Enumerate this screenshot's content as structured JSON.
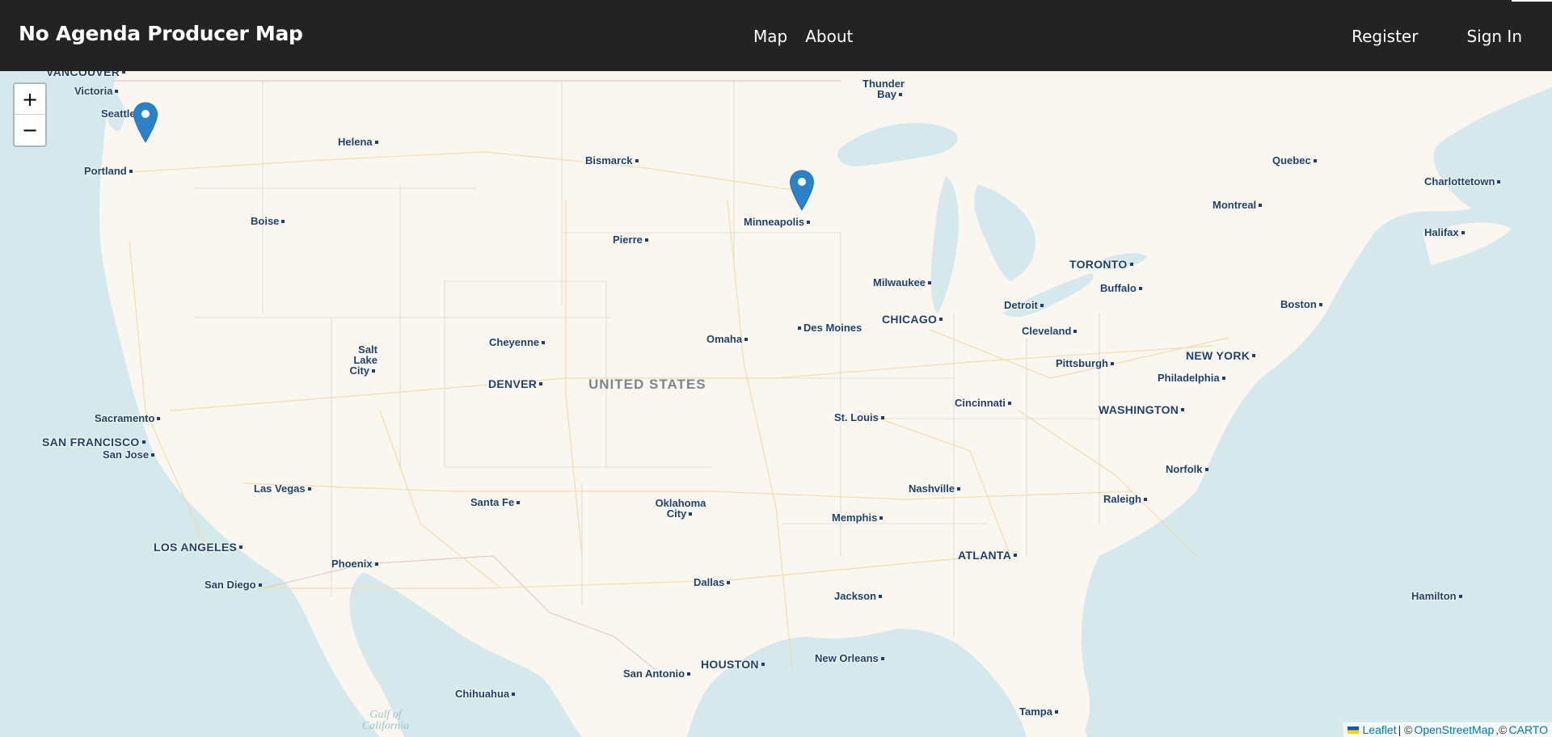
{
  "navbar": {
    "brand": "No Agenda Producer Map",
    "links": [
      "Map",
      "About"
    ],
    "register": "Register",
    "sign_in": "Sign In"
  },
  "zoom": {
    "in": "+",
    "out": "−"
  },
  "map": {
    "country_label": "UNITED STATES",
    "water_label": "Gulf of California",
    "cities": {
      "vancouver": "VANCOUVER",
      "victoria": "Victoria",
      "seattle": "Seattle",
      "portland": "Portland",
      "helena": "Helena",
      "boise": "Boise",
      "bismarck": "Bismarck",
      "pierre": "Pierre",
      "thunder_bay": "Thunder Bay",
      "minneapolis": "Minneapolis",
      "quebec": "Quebec",
      "charlottetown": "Charlottetown",
      "montreal": "Montreal",
      "halifax": "Halifax",
      "toronto": "TORONTO",
      "buffalo": "Buffalo",
      "milwaukee": "Milwaukee",
      "detroit": "Detroit",
      "boston": "Boston",
      "chicago": "CHICAGO",
      "cleveland": "Cleveland",
      "des_moines": "Des Moines",
      "omaha": "Omaha",
      "cheyenne": "Cheyenne",
      "salt_lake_city": "Salt Lake City",
      "denver": "DENVER",
      "pittsburgh": "Pittsburgh",
      "new_york": "NEW YORK",
      "philadelphia": "Philadelphia",
      "washington": "WASHINGTON",
      "cincinnati": "Cincinnati",
      "st_louis": "St. Louis",
      "sacramento": "Sacramento",
      "san_francisco": "SAN FRANCISCO",
      "san_jose": "San Jose",
      "las_vegas": "Las Vegas",
      "santa_fe": "Santa Fe",
      "oklahoma_city": "Oklahoma City",
      "nashville": "Nashville",
      "norfolk": "Norfolk",
      "raleigh": "Raleigh",
      "memphis": "Memphis",
      "los_angeles": "LOS ANGELES",
      "phoenix": "Phoenix",
      "atlanta": "ATLANTA",
      "san_diego": "San Diego",
      "dallas": "Dallas",
      "jackson": "Jackson",
      "hamilton": "Hamilton",
      "houston": "HOUSTON",
      "new_orleans": "New Orleans",
      "san_antonio": "San Antonio",
      "chihuahua": "Chihuahua",
      "tampa": "Tampa"
    },
    "markers": [
      "Seattle producer marker",
      "Minneapolis producer marker"
    ]
  },
  "attribution": {
    "leaflet": "Leaflet",
    "separator": " | ©",
    "osm": "OpenStreetMap",
    "carto_prefix": ",©",
    "carto": "CARTO"
  },
  "colors": {
    "navbar_bg": "#232323",
    "land": "#faf7f1",
    "water": "#d5e8eb",
    "marker": "#2b82cb",
    "city_label": "#1f3f66"
  }
}
